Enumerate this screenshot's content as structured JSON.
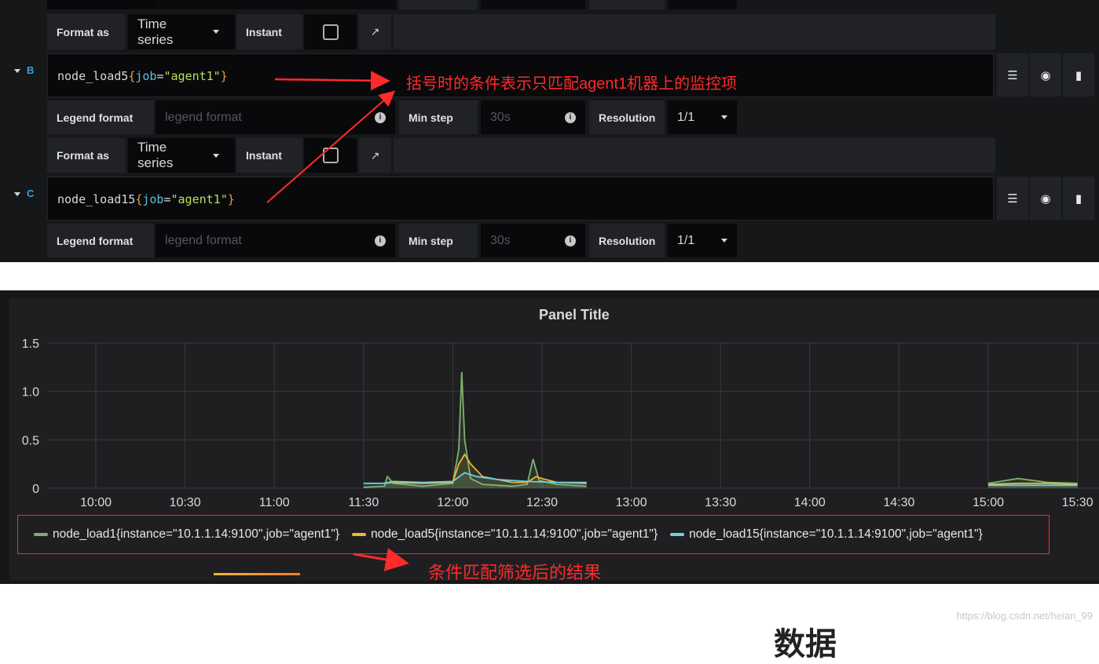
{
  "query_editor": {
    "rows": [
      {
        "format_label": "Format as",
        "format_value": "Time series",
        "instant_label": "Instant"
      },
      {
        "letter": "B",
        "expr_metric": "node_load5",
        "expr_key": "job",
        "expr_value": "\"agent1\"",
        "legend_label": "Legend format",
        "legend_placeholder": "legend format",
        "minstep_label": "Min step",
        "minstep_placeholder": "30s",
        "resolution_label": "Resolution",
        "resolution_value": "1/1",
        "format_label": "Format as",
        "format_value": "Time series",
        "instant_label": "Instant"
      },
      {
        "letter": "C",
        "expr_metric": "node_load15",
        "expr_key": "job",
        "expr_value": "\"agent1\"",
        "legend_label": "Legend format",
        "legend_placeholder": "legend format",
        "minstep_label": "Min step",
        "minstep_placeholder": "30s",
        "resolution_label": "Resolution",
        "resolution_value": "1/1"
      }
    ],
    "annotation_top": "括号时的条件表示只匹配agent1机器上的监控项"
  },
  "panel": {
    "title": "Panel Title",
    "annotation_bottom": "条件匹配筛选后的结果"
  },
  "chart_data": {
    "type": "line",
    "title": "Panel Title",
    "x": [
      "10:00",
      "10:30",
      "11:00",
      "11:30",
      "12:00",
      "12:30",
      "13:00",
      "13:30",
      "14:00",
      "14:30",
      "15:00",
      "15:30"
    ],
    "yticks": [
      "0",
      "0.5",
      "1.0",
      "1.5"
    ],
    "ylim": [
      0,
      1.5
    ],
    "grid": true,
    "legend_position": "bottom",
    "series": [
      {
        "name": "node_load1{instance=\"10.1.1.14:9100\",job=\"agent1\"}",
        "color": "#7eb26d",
        "points": [
          [
            "11:30",
            0.01
          ],
          [
            "11:37",
            0.02
          ],
          [
            "11:38",
            0.12
          ],
          [
            "11:40",
            0.05
          ],
          [
            "11:50",
            0.02
          ],
          [
            "12:00",
            0.05
          ],
          [
            "12:02",
            0.4
          ],
          [
            "12:03",
            1.2
          ],
          [
            "12:04",
            0.5
          ],
          [
            "12:06",
            0.1
          ],
          [
            "12:10",
            0.04
          ],
          [
            "12:20",
            0.02
          ],
          [
            "12:25",
            0.04
          ],
          [
            "12:27",
            0.3
          ],
          [
            "12:29",
            0.08
          ],
          [
            "12:35",
            0.04
          ],
          [
            "12:45",
            0.02
          ],
          [
            "15:00",
            0.05
          ],
          [
            "15:10",
            0.1
          ],
          [
            "15:20",
            0.06
          ],
          [
            "15:30",
            0.05
          ]
        ]
      },
      {
        "name": "node_load5{instance=\"10.1.1.14:9100\",job=\"agent1\"}",
        "color": "#eab839",
        "points": [
          [
            "11:37",
            0.05
          ],
          [
            "11:40",
            0.06
          ],
          [
            "11:50",
            0.05
          ],
          [
            "12:00",
            0.06
          ],
          [
            "12:02",
            0.25
          ],
          [
            "12:04",
            0.35
          ],
          [
            "12:06",
            0.25
          ],
          [
            "12:10",
            0.12
          ],
          [
            "12:20",
            0.06
          ],
          [
            "12:25",
            0.06
          ],
          [
            "12:28",
            0.12
          ],
          [
            "12:30",
            0.1
          ],
          [
            "12:35",
            0.06
          ],
          [
            "12:45",
            0.05
          ],
          [
            "15:00",
            0.04
          ],
          [
            "15:10",
            0.05
          ],
          [
            "15:20",
            0.05
          ],
          [
            "15:30",
            0.04
          ]
        ]
      },
      {
        "name": "node_load15{instance=\"10.1.1.14:9100\",job=\"agent1\"}",
        "color": "#6ed0e0",
        "points": [
          [
            "11:30",
            0.05
          ],
          [
            "11:35",
            0.05
          ],
          [
            "11:37",
            0.05
          ],
          [
            "11:40",
            0.07
          ],
          [
            "11:50",
            0.06
          ],
          [
            "12:00",
            0.07
          ],
          [
            "12:04",
            0.16
          ],
          [
            "12:08",
            0.12
          ],
          [
            "12:15",
            0.09
          ],
          [
            "12:25",
            0.07
          ],
          [
            "12:35",
            0.06
          ],
          [
            "12:45",
            0.06
          ],
          [
            "15:00",
            0.03
          ],
          [
            "15:10",
            0.03
          ],
          [
            "15:20",
            0.03
          ],
          [
            "15:30",
            0.03
          ]
        ]
      }
    ]
  },
  "watermark": "https://blog.csdn.net/heian_99",
  "bottom_text": [
    "数据"
  ]
}
